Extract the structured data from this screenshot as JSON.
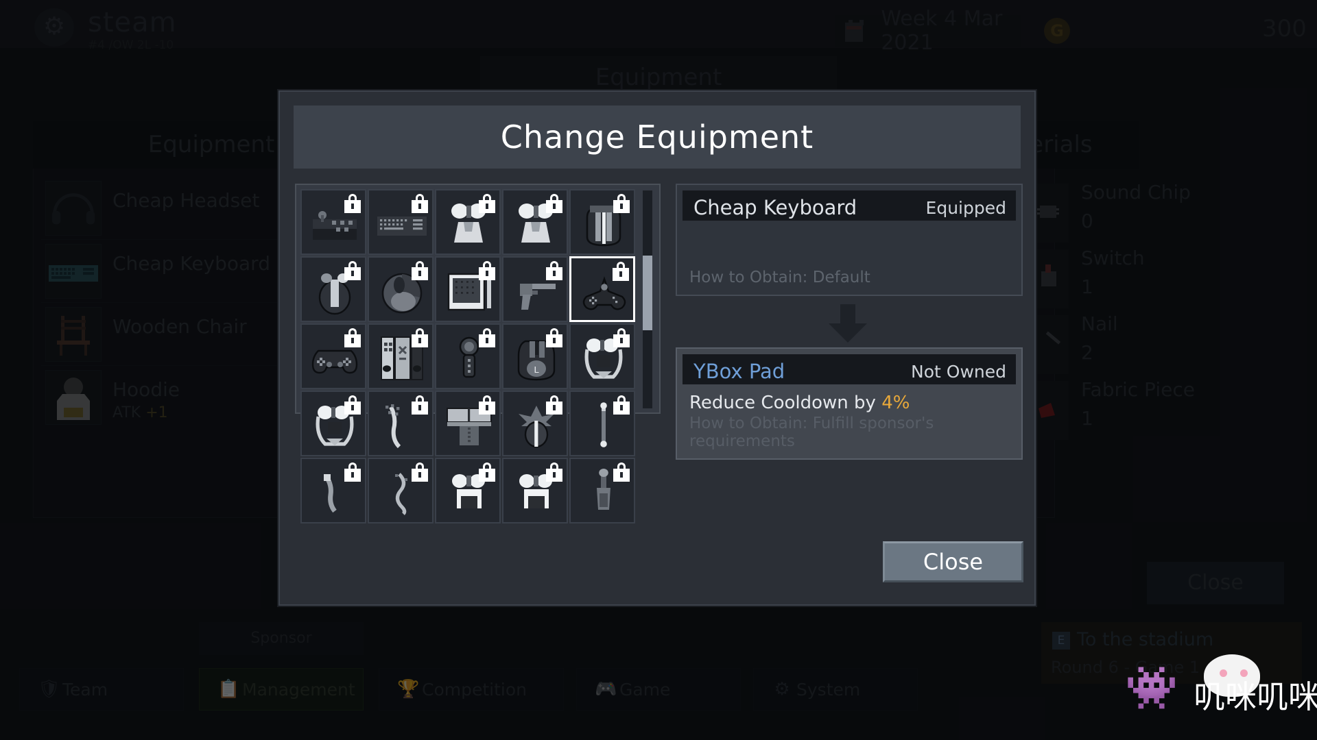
{
  "topbar": {
    "app_name": "steam",
    "app_sub": "#4 /OW 2L -10",
    "date": "Week 4 Mar 2021",
    "currency": "300",
    "calendar_icon": "calendar-icon",
    "coin_icon": "coin-icon",
    "gear_icon": "gear-icon"
  },
  "background": {
    "page_title": "Equipment",
    "equipment_panel": {
      "header": "Equipment",
      "items": [
        {
          "name": "Cheap Headset",
          "stat": "",
          "icon": "headset-icon"
        },
        {
          "name": "Cheap Keyboard",
          "stat": "",
          "icon": "keyboard-icon"
        },
        {
          "name": "Wooden Chair",
          "stat": "",
          "icon": "chair-icon"
        },
        {
          "name": "Hoodie",
          "stat_label": "ATK",
          "stat_value": "+1",
          "icon": "hoodie-icon"
        }
      ]
    },
    "materials_panel": {
      "header": "Owned Materials",
      "items": [
        {
          "name": "Sound Chip",
          "qty": "0",
          "icon": "sound-chip-icon"
        },
        {
          "name": "Switch",
          "qty": "1",
          "icon": "switch-icon"
        },
        {
          "name": "Nail",
          "qty": "2",
          "icon": "nail-icon"
        },
        {
          "name": "Fabric Piece",
          "qty": "1",
          "icon": "fabric-piece-icon"
        }
      ]
    },
    "close_label": "Close",
    "sponsor_label": "Sponsor",
    "stadium": {
      "key": "E",
      "line1": "To the stadium",
      "line2": "Round 6 - Game 1"
    }
  },
  "navbar": {
    "tabs": [
      {
        "label": "Team",
        "icon": "shield-icon",
        "active": false
      },
      {
        "label": "Management",
        "icon": "clipboard-icon",
        "active": true
      },
      {
        "label": "Competition",
        "icon": "trophy-icon",
        "active": false
      },
      {
        "label": "Game",
        "icon": "gamepad-icon",
        "active": false
      },
      {
        "label": "System",
        "icon": "gear-icon",
        "active": false
      }
    ]
  },
  "modal": {
    "title": "Change Equipment",
    "close_label": "Close",
    "arrow_icon": "arrow-down-icon",
    "scrollbar": {
      "name": "grid-scrollbar",
      "thumb_top_pct": 30,
      "thumb_height_pct": 34
    },
    "grid": {
      "columns": 5,
      "selected_index": 9,
      "cells": [
        {
          "icon": "arcade-stick-icon",
          "locked": true
        },
        {
          "icon": "keyboard-icon",
          "locked": true
        },
        {
          "icon": "headphones-white-icon",
          "locked": true
        },
        {
          "icon": "headphones-white-2-icon",
          "locked": true
        },
        {
          "icon": "mouse-striped-icon",
          "locked": true
        },
        {
          "icon": "mouse-tall-icon",
          "locked": true
        },
        {
          "icon": "mouse-round-icon",
          "locked": true
        },
        {
          "icon": "drawing-tablet-icon",
          "locked": true
        },
        {
          "icon": "light-gun-icon",
          "locked": true
        },
        {
          "icon": "xbox-gamepad-icon",
          "locked": true
        },
        {
          "icon": "ps-gamepad-icon",
          "locked": true
        },
        {
          "icon": "switch-console-icon",
          "locked": true
        },
        {
          "icon": "wii-remote-icon",
          "locked": true
        },
        {
          "icon": "mouse-logi-icon",
          "locked": true
        },
        {
          "icon": "headset-mic-icon",
          "locked": true
        },
        {
          "icon": "headset-mic-2-icon",
          "locked": true
        },
        {
          "icon": "cable-icon",
          "locked": true
        },
        {
          "icon": "laptop-icon",
          "locked": true
        },
        {
          "icon": "mouse-wing-icon",
          "locked": true
        },
        {
          "icon": "stylus-icon",
          "locked": true
        },
        {
          "icon": "pen-icon",
          "locked": true
        },
        {
          "icon": "wire-icon",
          "locked": true
        },
        {
          "icon": "headset-band-icon",
          "locked": true
        },
        {
          "icon": "headset-band-2-icon",
          "locked": true
        },
        {
          "icon": "joystick-icon",
          "locked": true
        }
      ]
    },
    "equipped_item": {
      "name": "Cheap Keyboard",
      "status": "Equipped",
      "effect": "",
      "how_to_obtain": "How to Obtain: Default"
    },
    "target_item": {
      "name": "YBox Pad",
      "status": "Not Owned",
      "effect_prefix": "Reduce Cooldown by",
      "effect_value": "4%",
      "how_to_obtain": "How to Obtain: Fulfill sponsor's requirements"
    }
  },
  "watermark": {
    "text": "叽咪叽咪",
    "icon": "space-invader-icon"
  },
  "colors": {
    "accent_gold": "#e9a93a",
    "link_blue": "#6f9fd8",
    "modal_bg": "#2b2f36",
    "title_bar": "#3d434c",
    "button": "#6b7783"
  }
}
